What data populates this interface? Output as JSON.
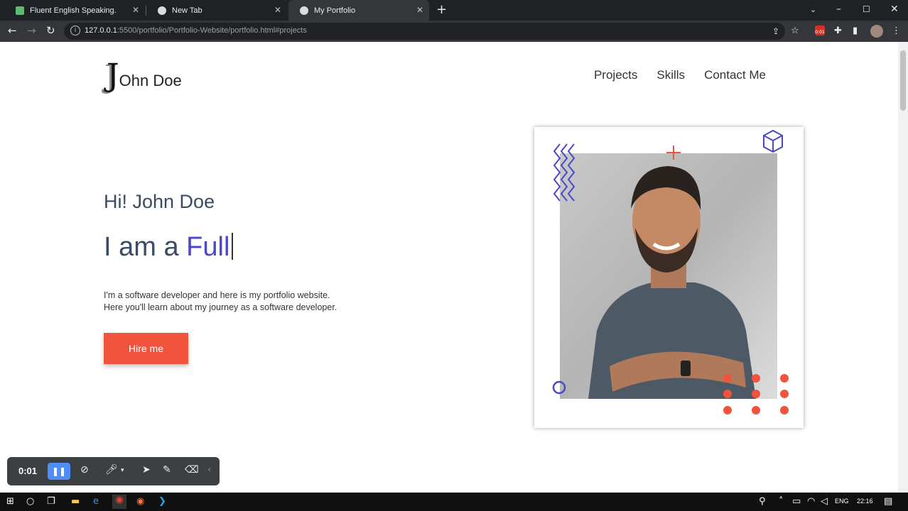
{
  "browser": {
    "tabs": [
      {
        "title": "Fluent English Speaking.",
        "favicon_color": "#5bb974",
        "active": false
      },
      {
        "title": "New Tab",
        "favicon_color": "#dadce0",
        "active": false
      },
      {
        "title": "My Portfolio",
        "favicon_color": "#dadce0",
        "active": true
      }
    ],
    "url_host": "127.0.0.1",
    "url_rest": ":5500/portfolio/Portfolio-Website/portfolio.html#projects",
    "extension_badge": "0:01"
  },
  "site": {
    "logo_initial": "J",
    "logo_text": "Ohn Doe",
    "nav": [
      "Projects",
      "Skills",
      "Contact Me"
    ],
    "greeting": "Hi! John Doe",
    "iam_prefix": "I am a ",
    "iam_highlight": "Full",
    "intro_line1": "I'm a software developer and here is my portfolio website.",
    "intro_line2": "Here you'll learn about my journey as a software developer.",
    "hire_label": "Hire me",
    "accent_color": "#4a47c9",
    "cta_color": "#f0543c"
  },
  "recorder": {
    "time": "0:01"
  },
  "taskbar": {
    "lang": "ENG",
    "clock": "22:16"
  }
}
